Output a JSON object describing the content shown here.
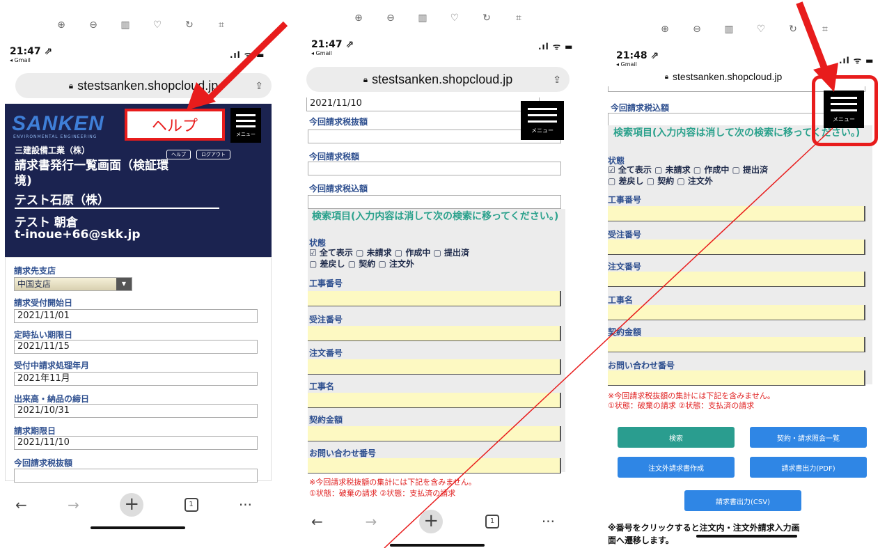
{
  "url": "stestsanken.shopcloud.jp",
  "url_truncated": "stestsanken.shopcloud.jp",
  "back_app": "◂ Gmail",
  "tabs_count": "1",
  "menu_label": "メニュー",
  "panel1": {
    "time": "21:47 ⇗",
    "logo": "SANKEN",
    "logo_sub": "ENVIRONMENTAL ENGINEERING",
    "help_big": "ヘルプ",
    "help_small": "ヘルプ",
    "logout": "ログアウト",
    "company": "三建設備工業（株）",
    "page_title_1": "請求書発行一覧画面（検証環",
    "page_title_2": "境)",
    "client": "テスト石原（株）",
    "user": "テスト 朝倉",
    "email": "t-inoue+66@skk.jp",
    "fields": {
      "branch_label": "請求先支店",
      "branch_value": "中国支店",
      "start_label": "請求受付開始日",
      "start_value": "2021/11/01",
      "due_label": "定時払い期限日",
      "due_value": "2021/11/15",
      "ym_label": "受付中請求処理年月",
      "ym_value": "2021年11月",
      "cutoff_label": "出来高・納品の締日",
      "cutoff_value": "2021/10/31",
      "period_label": "請求期限日",
      "period_value": "2021/11/10",
      "taxex_label": "今回請求税抜額"
    }
  },
  "panel2": {
    "time": "21:47 ⇗",
    "top_value": "2021/11/10",
    "taxex_label": "今回請求税抜額",
    "tax_label": "今回請求税額",
    "taxin_label": "今回請求税込額",
    "search_heading": "検索項目(入力内容は消して次の検索に移ってください。)",
    "status_label": "状態",
    "status_line1": "☑ 全て表示 ▢ 未請求 ▢ 作成中 ▢ 提出済",
    "status_line2": "▢ 差戻し ▢ 契約 ▢ 注文外",
    "f_koji": "工事番号",
    "f_juchu": "受注番号",
    "f_chumon": "注文番号",
    "f_kojimei": "工事名",
    "f_keiyaku": "契約金額",
    "f_toiawase": "お問い合わせ番号",
    "note1": "※今回請求税抜額の集計には下記を含みません。",
    "note2": "①状態：破棄の請求 ②状態：支払済の請求"
  },
  "panel3": {
    "time": "21:48 ⇗",
    "taxin_label": "今回請求税込額",
    "search_heading": "検索項目(入力内容は消して次の検索に移ってください。)",
    "status_label": "状態",
    "status_line1": "☑ 全て表示 ▢ 未請求 ▢ 作成中 ▢ 提出済",
    "status_line2": "▢ 差戻し ▢ 契約 ▢ 注文外",
    "f_koji": "工事番号",
    "f_juchu": "受注番号",
    "f_chumon": "注文番号",
    "f_kojimei": "工事名",
    "f_keiyaku": "契約金額",
    "f_toiawase": "お問い合わせ番号",
    "note1": "※今回請求税抜額の集計には下記を含みません。",
    "note2": "①状態：破棄の請求 ②状態：支払済の請求",
    "btn_search": "検索",
    "btn_inquiry": "契約・請求照会一覧",
    "btn_create": "注文外請求書作成",
    "btn_pdf": "請求書出力(PDF)",
    "btn_csv": "請求書出力(CSV)",
    "footer_1": "※番号をクリックすると注文内・注文外請求入力画",
    "footer_2": "面へ遷移します。"
  },
  "colors": {
    "highlight_red": "#e81c1c",
    "header_navy": "#1b2350",
    "accent_green": "#2aa18c",
    "button_blue": "#2f86e5"
  }
}
